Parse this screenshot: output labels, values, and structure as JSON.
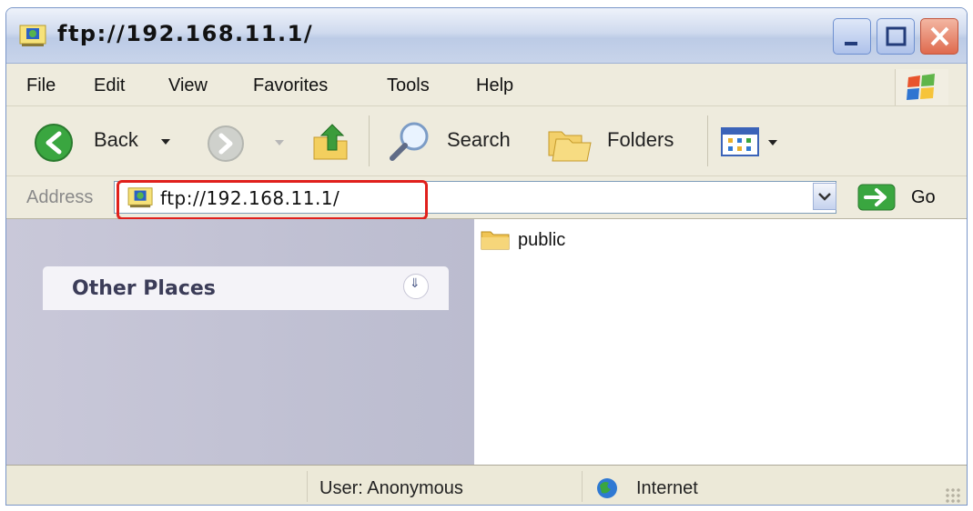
{
  "window": {
    "title": "ftp://192.168.11.1/"
  },
  "menu": {
    "items": [
      "File",
      "Edit",
      "View",
      "Favorites",
      "Tools",
      "Help"
    ]
  },
  "toolbar": {
    "back_label": "Back",
    "search_label": "Search",
    "folders_label": "Folders"
  },
  "address": {
    "label": "Address",
    "value": "ftp://192.168.11.1/",
    "go_label": "Go"
  },
  "sidebar": {
    "panel_title": "Other Places"
  },
  "content": {
    "items": [
      {
        "name": "public",
        "icon": "folder-icon"
      }
    ]
  },
  "status": {
    "user": "User: Anonymous",
    "zone": "Internet"
  },
  "colors": {
    "highlight": "#e0201c",
    "sidebar_bg": "#c2c2d5",
    "back_green": "#3aa640"
  }
}
